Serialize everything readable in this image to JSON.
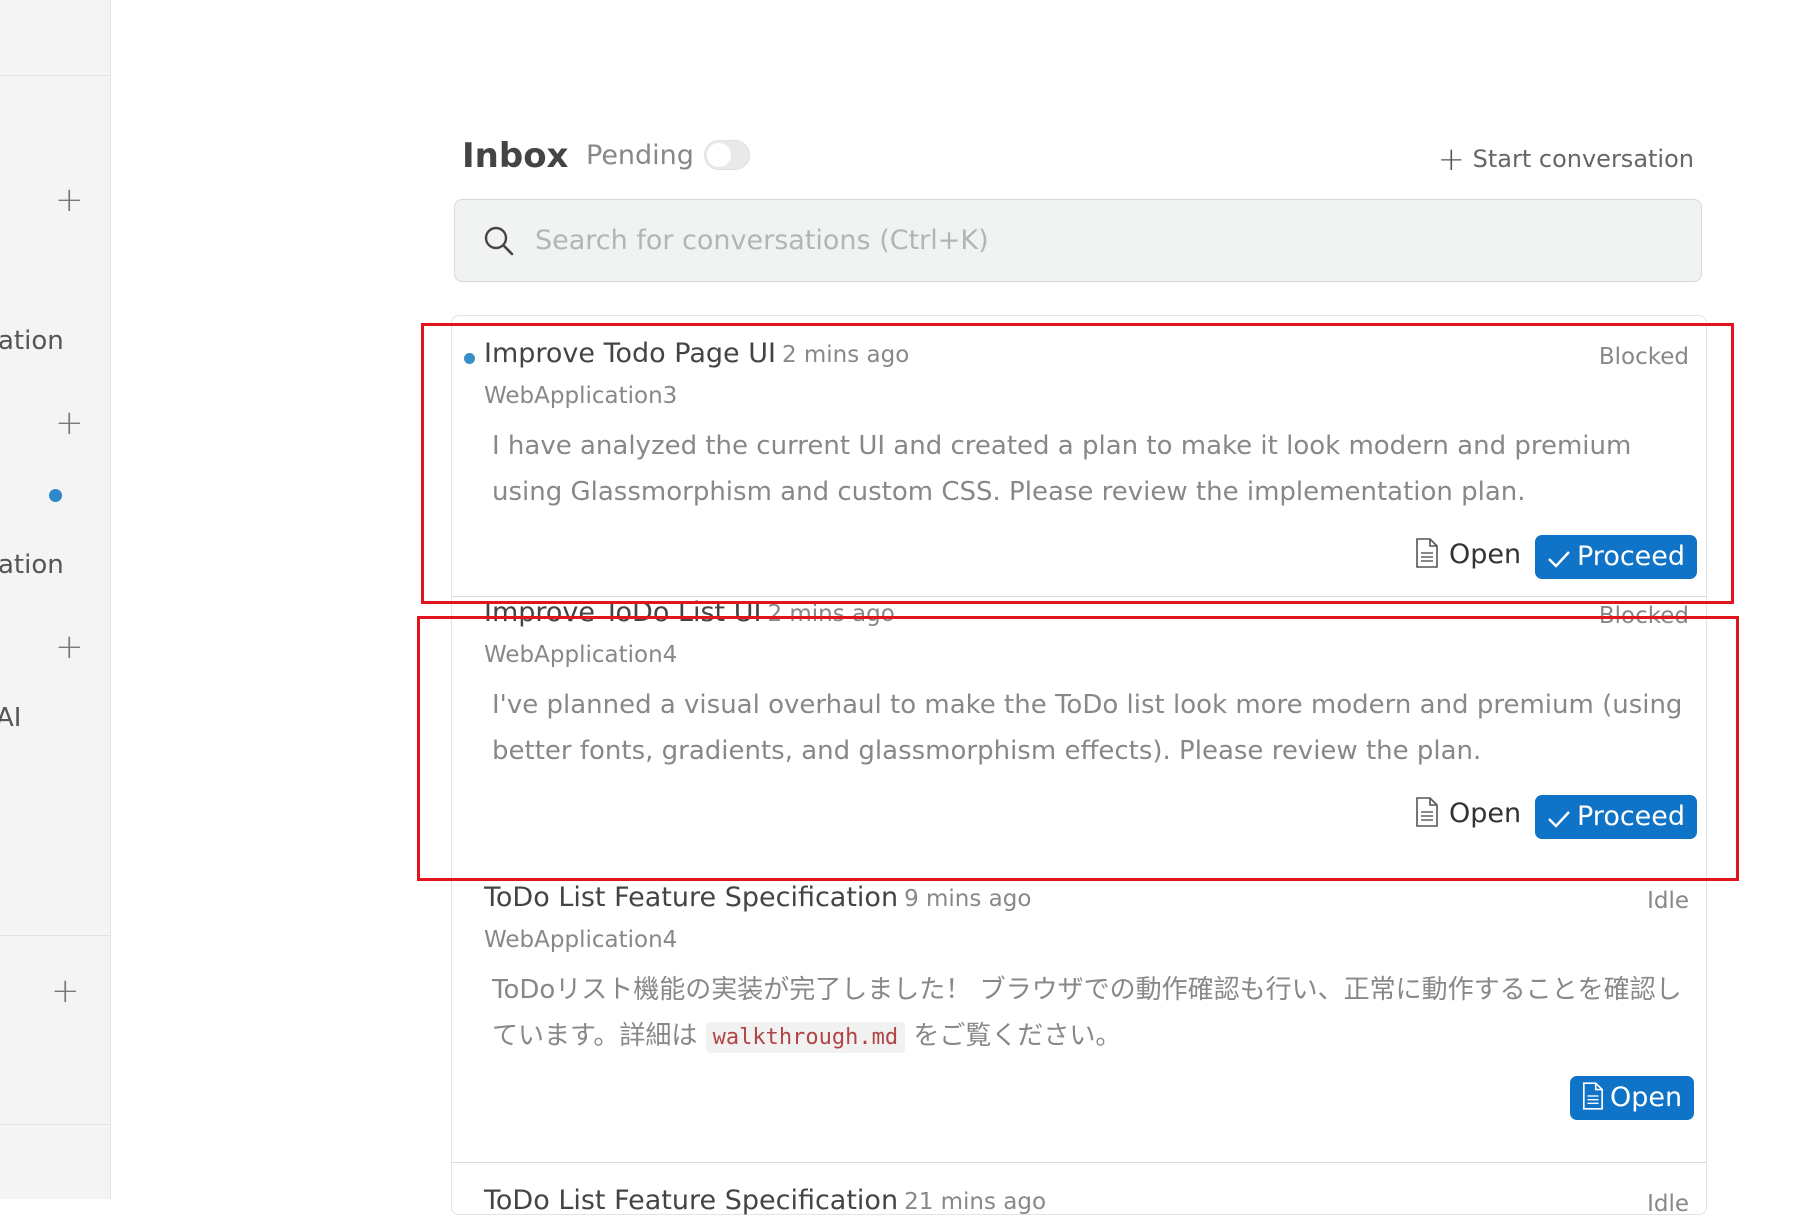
{
  "sidebar": {
    "labels": [
      "ation",
      "ation",
      "AI"
    ],
    "add_icons": [
      "plus-icon",
      "plus-icon",
      "plus-icon",
      "plus-icon"
    ]
  },
  "header": {
    "title": "Inbox",
    "pending_label": "Pending",
    "pending_enabled": false,
    "start_conversation_label": "Start conversation"
  },
  "search": {
    "placeholder": "Search for conversations (Ctrl+K)",
    "value": ""
  },
  "conversations": [
    {
      "title": "Improve Todo Page UI",
      "time": "2 mins ago",
      "status": "Blocked",
      "project": "WebApplication3",
      "body": "I have analyzed the current UI and created a plan to make it look modern and premium using Glassmorphism and custom CSS. Please review the implementation plan.",
      "unread": true,
      "open_label": "Open",
      "proceed_label": "Proceed"
    },
    {
      "title": "Improve ToDo List UI",
      "time": "2 mins ago",
      "status": "Blocked",
      "project": "WebApplication4",
      "body": "I've planned a visual overhaul to make the ToDo list look more modern and premium (using better fonts, gradients, and glassmorphism effects). Please review the plan.",
      "unread": false,
      "open_label": "Open",
      "proceed_label": "Proceed"
    },
    {
      "title": "ToDo List Feature Specification",
      "time": "9 mins ago",
      "status": "Idle",
      "project": "WebApplication4",
      "body_before_code": "ToDoリスト機能の実装が完了しました！ ブラウザでの動作確認も行い、正常に動作することを確認しています。詳細は ",
      "body_code": "walkthrough.md",
      "body_after_code": " をご覧ください。",
      "unread": false,
      "open_label": "Open"
    },
    {
      "title": "ToDo List Feature Specification",
      "time": "21 mins ago",
      "status": "Idle"
    }
  ],
  "colors": {
    "accent": "#0f73c7",
    "unread_dot": "#3a8ec6",
    "highlight": "#e2141e"
  }
}
